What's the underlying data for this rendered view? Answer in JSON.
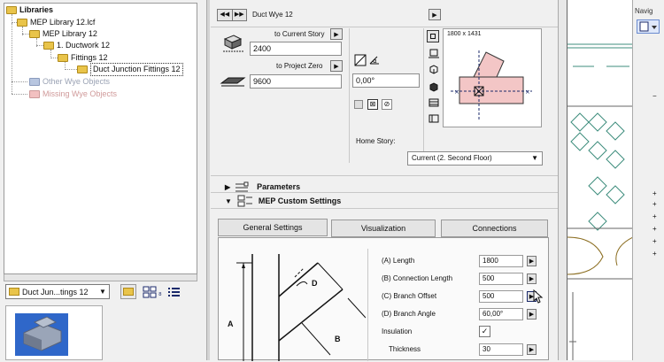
{
  "library_tree": {
    "root": "Libraries",
    "items": [
      {
        "label": "MEP Library 12.lcf",
        "kind": "folder"
      },
      {
        "label": "MEP Library 12",
        "kind": "folder"
      },
      {
        "label": "1. Ductwork 12",
        "kind": "folder"
      },
      {
        "label": "Fittings 12",
        "kind": "folder"
      },
      {
        "label": "Duct Junction Fittings 12",
        "kind": "folder",
        "selected": true
      },
      {
        "label": "Other Wye Objects",
        "kind": "folder-dim"
      },
      {
        "label": "Missing Wye Objects",
        "kind": "folder-missing"
      }
    ]
  },
  "library_bottom": {
    "combo_value": "Duct Jun...tings 12",
    "view_mode_text": "₈"
  },
  "header": {
    "object_name": "Duct Wye 12"
  },
  "geometry": {
    "to_current_story_label": "to Current Story",
    "to_current_story_value": "2400",
    "to_project_zero_label": "to Project Zero",
    "to_project_zero_value": "9600",
    "angle_value": "0,00°",
    "preview_size": "1800 x 1431",
    "home_story_label": "Home Story:",
    "home_story_value": "Current (2. Second Floor)"
  },
  "sections": {
    "parameters_label": "Parameters",
    "mep_label": "MEP Custom Settings"
  },
  "tabs": [
    {
      "label": "General Settings",
      "active": true
    },
    {
      "label": "Visualization",
      "active": false
    },
    {
      "label": "Connections",
      "active": false
    }
  ],
  "parameters": [
    {
      "label": "(A) Length",
      "value": "1800"
    },
    {
      "label": "(B) Connection Length",
      "value": "500"
    },
    {
      "label": "(C) Branch Offset",
      "value": "500"
    },
    {
      "label": "(D) Branch Angle",
      "value": "60,00°"
    },
    {
      "label": "Insulation",
      "value": "✓"
    },
    {
      "label": "Thickness",
      "value": "30"
    }
  ],
  "diagram_labels": {
    "a": "A",
    "b": "B",
    "d": "D"
  },
  "navigator": {
    "title": "Navig"
  },
  "colors": {
    "accent_pink": "#f3c6c6",
    "selection_navy": "#1b2a6b",
    "folder_yellow": "#e9c44a",
    "canvas_teal": "#3c8c7c"
  }
}
